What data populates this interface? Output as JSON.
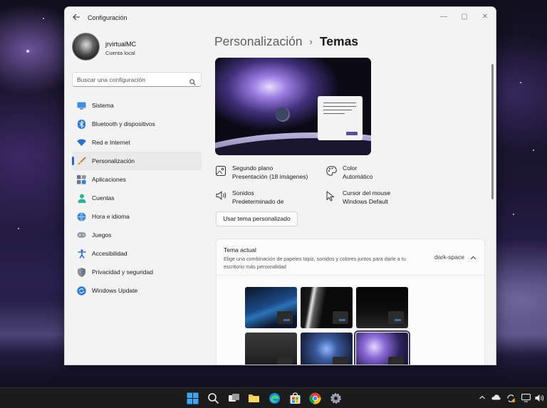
{
  "window": {
    "title": "Configuración",
    "controls": {
      "minimize": "—",
      "maximize": "▢",
      "close": "✕"
    }
  },
  "profile": {
    "name": "jrvirtualMC",
    "account_type": "Cuenta local"
  },
  "search": {
    "placeholder": "Buscar una configuración"
  },
  "nav": {
    "items": [
      {
        "label": "Sistema",
        "icon": "monitor-icon"
      },
      {
        "label": "Bluetooth y dispositivos",
        "icon": "bluetooth-icon"
      },
      {
        "label": "Red e Internet",
        "icon": "wifi-icon"
      },
      {
        "label": "Personalización",
        "icon": "paintbrush-icon",
        "active": true
      },
      {
        "label": "Aplicaciones",
        "icon": "apps-icon"
      },
      {
        "label": "Cuentas",
        "icon": "person-icon"
      },
      {
        "label": "Hora e idioma",
        "icon": "globe-clock-icon"
      },
      {
        "label": "Juegos",
        "icon": "gamepad-icon"
      },
      {
        "label": "Accesibilidad",
        "icon": "accessibility-icon"
      },
      {
        "label": "Privacidad y seguridad",
        "icon": "shield-icon"
      },
      {
        "label": "Windows Update",
        "icon": "update-icon"
      }
    ]
  },
  "breadcrumb": {
    "parent": "Personalización",
    "separator": "›",
    "current": "Temas"
  },
  "properties": {
    "background": {
      "title": "Segundo plano",
      "value": "Presentación (18 imágenes)"
    },
    "color": {
      "title": "Color",
      "value": "Automático"
    },
    "sounds": {
      "title": "Sonidos",
      "value": "Predeterminado de"
    },
    "cursor": {
      "title": "Cursor del mouse",
      "value": "Windows Default"
    }
  },
  "custom_theme_button": "Usar tema personalizado",
  "current_theme": {
    "title": "Tema actual",
    "description": "Elige una combinación de papeles tapiz, sonidos y colores juntos para darle a tu escritorio más personalidad",
    "value": "dark-space"
  },
  "colors": {
    "accent": "#2c62c8",
    "window_bg": "#f3f3f3",
    "taskbar_bg": "#1c1c1c"
  }
}
